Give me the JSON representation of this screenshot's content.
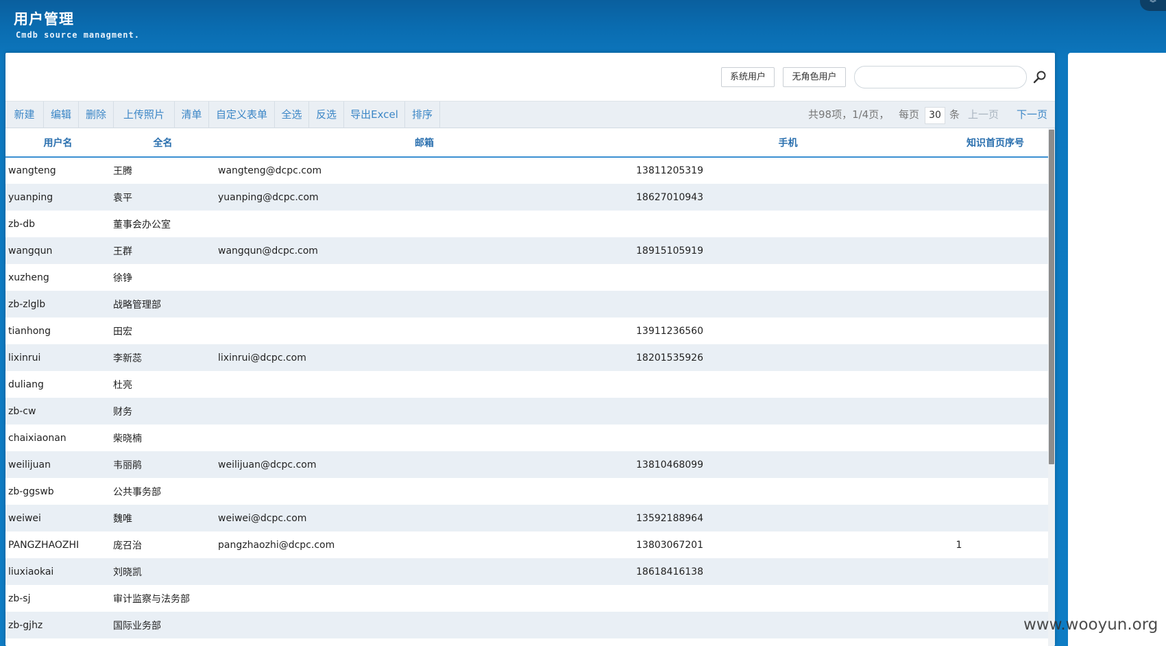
{
  "header": {
    "title": "用户管理",
    "subtitle": "Cmdb source managment."
  },
  "filters": {
    "system_users": "系统用户",
    "no_role_users": "无角色用户",
    "search_value": "",
    "search_placeholder": ""
  },
  "toolbar": {
    "new": "新建",
    "edit": "编辑",
    "delete": "删除",
    "upload_photo": "上传照片",
    "clear": "清单",
    "custom_form": "自定义表单",
    "select_all": "全选",
    "invert": "反选",
    "export_excel": "导出Excel",
    "sort": "排序"
  },
  "pager": {
    "summary": "共98项，1/4页，",
    "per_page_label": "每页",
    "per_page": "30",
    "unit": "条",
    "prev": "上一页",
    "next": "下一页"
  },
  "table": {
    "columns": [
      "用户名",
      "全名",
      "邮箱",
      "手机",
      "知识首页序号"
    ],
    "rows": [
      [
        "wangteng",
        "王腾",
        "wangteng@dcpc.com",
        "13811205319",
        ""
      ],
      [
        "yuanping",
        "袁平",
        "yuanping@dcpc.com",
        "18627010943",
        ""
      ],
      [
        "zb-db",
        "董事会办公室",
        "",
        "",
        ""
      ],
      [
        "wangqun",
        "王群",
        "wangqun@dcpc.com",
        "18915105919",
        ""
      ],
      [
        "xuzheng",
        "徐铮",
        "",
        "",
        ""
      ],
      [
        "zb-zlglb",
        "战略管理部",
        "",
        "",
        ""
      ],
      [
        "tianhong",
        "田宏",
        "",
        "13911236560",
        ""
      ],
      [
        "lixinrui",
        "李新蕊",
        "lixinrui@dcpc.com",
        "18201535926",
        ""
      ],
      [
        "duliang",
        "杜亮",
        "",
        "",
        ""
      ],
      [
        "zb-cw",
        "财务",
        "",
        "",
        ""
      ],
      [
        "chaixiaonan",
        "柴晓楠",
        "",
        "",
        ""
      ],
      [
        "weilijuan",
        "韦丽鹃",
        "weilijuan@dcpc.com",
        "13810468099",
        ""
      ],
      [
        "zb-ggswb",
        "公共事务部",
        "",
        "",
        ""
      ],
      [
        "weiwei",
        "魏唯",
        "weiwei@dcpc.com",
        "13592188964",
        ""
      ],
      [
        "PANGZHAOZHI",
        "庞召治",
        "pangzhaozhi@dcpc.com",
        "13803067201",
        "1"
      ],
      [
        "liuxiaokai",
        "刘晓凯",
        "",
        "18618416138",
        ""
      ],
      [
        "zb-sj",
        "审计监察与法务部",
        "",
        "",
        ""
      ],
      [
        "zb-gjhz",
        "国际业务部",
        "",
        "",
        ""
      ]
    ]
  },
  "watermark": "www.wooyun.org",
  "colors": {
    "header_bg": "#0a6cb0",
    "link_blue": "#3b86c6",
    "header_text_blue": "#2a6fae",
    "row_stripe": "#e9eff5"
  }
}
